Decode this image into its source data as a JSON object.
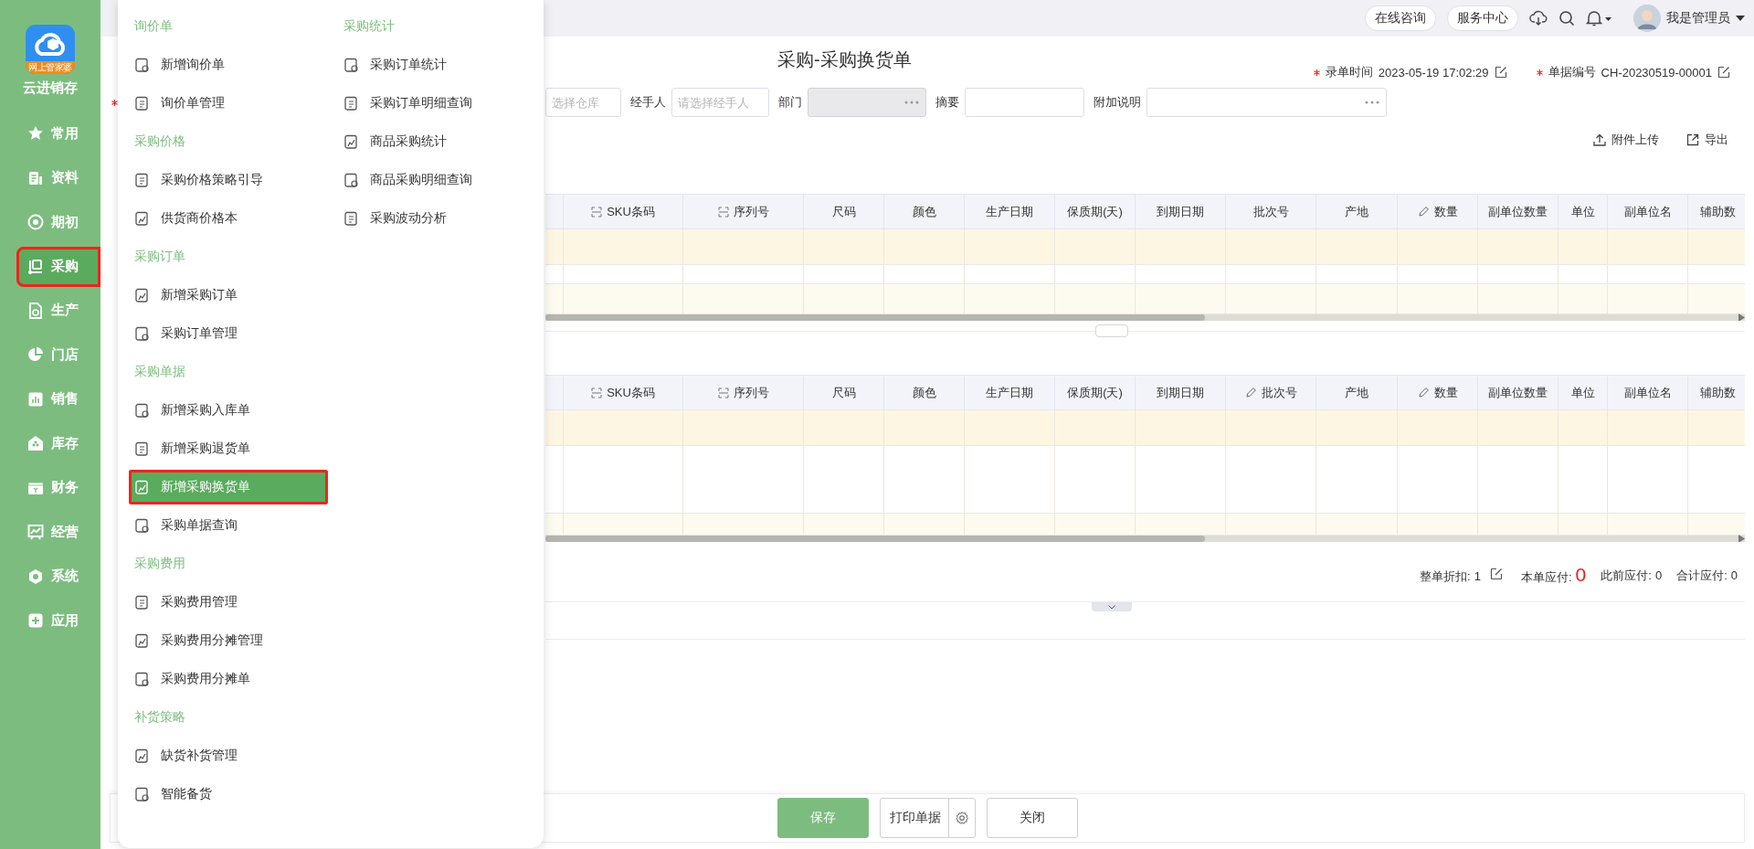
{
  "sidebar": {
    "logo_badge": "网上管家婆",
    "app_name": "云进销存",
    "items": [
      {
        "label": "常用",
        "selected": false
      },
      {
        "label": "资料",
        "selected": false
      },
      {
        "label": "期初",
        "selected": false
      },
      {
        "label": "采购",
        "selected": true
      },
      {
        "label": "生产",
        "selected": false
      },
      {
        "label": "门店",
        "selected": false
      },
      {
        "label": "销售",
        "selected": false
      },
      {
        "label": "库存",
        "selected": false
      },
      {
        "label": "财务",
        "selected": false
      },
      {
        "label": "经营",
        "selected": false
      },
      {
        "label": "系统",
        "selected": false
      },
      {
        "label": "应用",
        "selected": false
      }
    ]
  },
  "top_bar": {
    "links": [
      "在线咨询",
      "服务中心"
    ],
    "user": "我是管理员"
  },
  "menu": {
    "columns": [
      {
        "sections": [
          {
            "heading": "询价单",
            "items": [
              {
                "label": "新增询价单",
                "selected": false
              },
              {
                "label": "询价单管理",
                "selected": false
              }
            ]
          },
          {
            "heading": "采购价格",
            "items": [
              {
                "label": "采购价格策略引导",
                "selected": false
              },
              {
                "label": "供货商价格本",
                "selected": false
              }
            ]
          },
          {
            "heading": "采购订单",
            "items": [
              {
                "label": "新增采购订单",
                "selected": false
              },
              {
                "label": "采购订单管理",
                "selected": false
              }
            ]
          },
          {
            "heading": "采购单据",
            "items": [
              {
                "label": "新增采购入库单",
                "selected": false
              },
              {
                "label": "新增采购退货单",
                "selected": false
              },
              {
                "label": "新增采购换货单",
                "selected": true
              },
              {
                "label": "采购单据查询",
                "selected": false
              }
            ]
          },
          {
            "heading": "采购费用",
            "items": [
              {
                "label": "采购费用管理",
                "selected": false
              },
              {
                "label": "采购费用分摊管理",
                "selected": false
              },
              {
                "label": "采购费用分摊单",
                "selected": false
              }
            ]
          },
          {
            "heading": "补货策略",
            "items": [
              {
                "label": "缺货补货管理",
                "selected": false
              },
              {
                "label": "智能备货",
                "selected": false
              }
            ]
          }
        ]
      },
      {
        "sections": [
          {
            "heading": "采购统计",
            "items": [
              {
                "label": "采购订单统计",
                "selected": false
              },
              {
                "label": "采购订单明细查询",
                "selected": false
              },
              {
                "label": "商品采购统计",
                "selected": false
              },
              {
                "label": "商品采购明细查询",
                "selected": false
              },
              {
                "label": "采购波动分析",
                "selected": false
              }
            ]
          }
        ]
      }
    ]
  },
  "page": {
    "title": "采购-采购换货单",
    "meta": [
      {
        "label": "录单时间",
        "value": "2023-05-19 17:02:29",
        "required": true
      },
      {
        "label": "单据编号",
        "value": "CH-20230519-00001",
        "required": true
      }
    ],
    "form": {
      "required": true,
      "fields": [
        {
          "placeholder": "选择仓库",
          "kind": "text",
          "disabled": false
        },
        {
          "label": "经手人",
          "placeholder": "请选择经手人",
          "kind": "text",
          "disabled": false
        },
        {
          "label": "部门",
          "kind": "picker",
          "disabled": true
        },
        {
          "label": "摘要",
          "kind": "text",
          "disabled": false
        },
        {
          "label": "附加说明",
          "kind": "picker",
          "disabled": false
        }
      ]
    },
    "actions": [
      {
        "label": "附件上传",
        "kind": "upload"
      },
      {
        "label": "导出",
        "kind": "export"
      }
    ],
    "tables": [
      {
        "columns": [
          {
            "label": "SKU条码",
            "kind": "scan"
          },
          {
            "label": "序列号",
            "kind": "scan"
          },
          {
            "label": "尺码",
            "kind": "plain"
          },
          {
            "label": "颜色",
            "kind": "plain"
          },
          {
            "label": "生产日期",
            "kind": "plain"
          },
          {
            "label": "保质期(天)",
            "kind": "plain"
          },
          {
            "label": "到期日期",
            "kind": "plain"
          },
          {
            "label": "批次号",
            "kind": "plain"
          },
          {
            "label": "产地",
            "kind": "plain"
          },
          {
            "label": "数量",
            "kind": "editable"
          },
          {
            "label": "副单位数量",
            "kind": "plain"
          },
          {
            "label": "单位",
            "kind": "plain"
          },
          {
            "label": "副单位名",
            "kind": "plain"
          },
          {
            "label": "辅助数",
            "kind": "plain"
          }
        ]
      },
      {
        "columns": [
          {
            "label": "SKU条码",
            "kind": "scan"
          },
          {
            "label": "序列号",
            "kind": "scan"
          },
          {
            "label": "尺码",
            "kind": "plain"
          },
          {
            "label": "颜色",
            "kind": "plain"
          },
          {
            "label": "生产日期",
            "kind": "plain"
          },
          {
            "label": "保质期(天)",
            "kind": "plain"
          },
          {
            "label": "到期日期",
            "kind": "plain"
          },
          {
            "label": "批次号",
            "kind": "editable"
          },
          {
            "label": "产地",
            "kind": "plain"
          },
          {
            "label": "数量",
            "kind": "editable"
          },
          {
            "label": "副单位数量",
            "kind": "plain"
          },
          {
            "label": "单位",
            "kind": "plain"
          },
          {
            "label": "副单位名",
            "kind": "plain"
          },
          {
            "label": "辅助数",
            "kind": "plain"
          }
        ]
      }
    ],
    "summary": [
      {
        "label": "整单折扣:",
        "value": "1",
        "kind": "editable"
      },
      {
        "label": "本单应付:",
        "value": "0",
        "kind": "highlight"
      },
      {
        "label": "此前应付:",
        "value": "0",
        "kind": "plain"
      },
      {
        "label": "合计应付:",
        "value": "0",
        "kind": "plain"
      }
    ],
    "buttons": [
      {
        "label": "保存",
        "kind": "primary"
      },
      {
        "label": "打印单据",
        "kind": "split"
      },
      {
        "label": "关闭",
        "kind": "plain"
      }
    ]
  }
}
